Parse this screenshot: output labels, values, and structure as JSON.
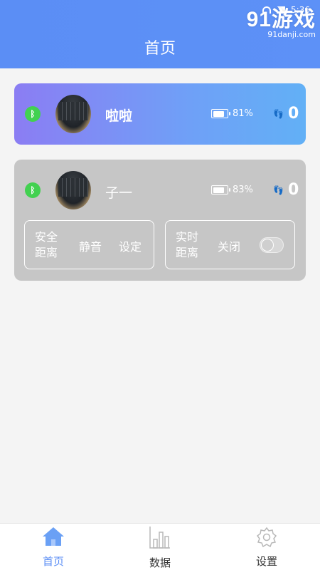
{
  "status_bar": {
    "time": "5:36"
  },
  "watermark": {
    "main": "91游戏",
    "sub": "91danji.com"
  },
  "header": {
    "title": "首页"
  },
  "devices": [
    {
      "name": "啦啦",
      "battery_percent": 81,
      "battery_label": "81%",
      "steps": "0",
      "state": "active"
    },
    {
      "name": "子一",
      "battery_percent": 83,
      "battery_label": "83%",
      "steps": "0",
      "state": "idle",
      "controls": {
        "safe_distance_label": "安全距离",
        "mute_option": "静音",
        "set_option": "设定",
        "realtime_distance_label": "实时距离",
        "toggle_state_label": "关闭",
        "toggle_on": false
      }
    }
  ],
  "tabbar": {
    "items": [
      {
        "label": "首页",
        "icon": "home-icon",
        "active": true
      },
      {
        "label": "数据",
        "icon": "bar-chart-icon",
        "active": false
      },
      {
        "label": "设置",
        "icon": "gear-icon",
        "active": false
      }
    ]
  },
  "colors": {
    "accent": "#5b8ef5",
    "bluetooth": "#42d150",
    "idle_card": "#c6c6c6"
  }
}
